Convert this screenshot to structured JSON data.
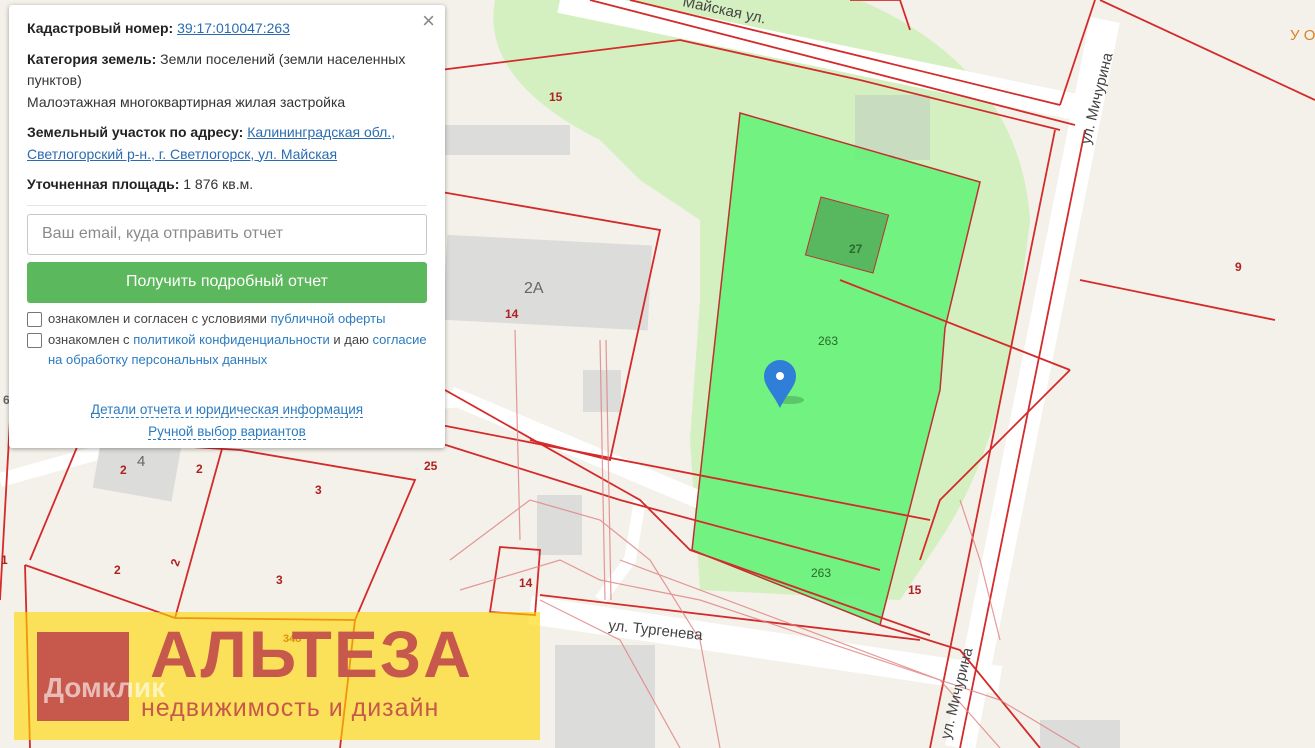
{
  "panel": {
    "close_icon": "×",
    "cadastral_label": "Кадастровый номер:",
    "cadastral_value": "39:17:010047:263",
    "category_label": "Категория земель:",
    "category_value": "Земли поселений (земли населенных пунктов)",
    "use_value": "Малоэтажная многоквартирная жилая застройка",
    "address_label": "Земельный участок по адресу:",
    "address_value": "Калининградская обл., Светлогорский р-н., г. Светлогорск, ул. Майская",
    "area_label": "Уточненная площадь:",
    "area_value": "1 876 кв.м.",
    "email_placeholder": "Ваш email, куда отправить отчет",
    "submit_label": "Получить подробный отчет",
    "consent1_text": "ознакомлен и согласен с условиями",
    "consent1_link": "публичной оферты",
    "consent2_text": "ознакомлен с",
    "consent2_link": "политикой конфиденциальности",
    "consent2_and": "и даю",
    "consent2_link2": "согласие на обработку персональных данных",
    "details_link": "Детали отчета и юридическая информация",
    "manual_link": "Ручной выбор вариантов"
  },
  "map": {
    "streets": {
      "mayskaya": "Майская ул.",
      "michurina_top": "ул. Мичурина",
      "michurina_bottom": "ул. Мичурина",
      "turgeneva": "ул. Тургенева"
    },
    "building_labels": {
      "b_2a": "2А",
      "b_4": "4"
    },
    "parcel_labels": {
      "p15a": "15",
      "p27": "27",
      "p263a": "263",
      "p263b": "263",
      "p9": "9",
      "p14a": "14",
      "p14b": "14",
      "p25": "25",
      "p2a": "2",
      "p2b": "2",
      "p2c": "2",
      "p2d": "2",
      "p3a": "3",
      "p3b": "3",
      "p15b": "15",
      "p1": "1",
      "p348": "348",
      "p_edge": "6"
    },
    "corner_text": "У О",
    "colors": {
      "selected_parcel": "#66f27a",
      "parcel_border": "#d42a2a",
      "park": "#d4f0c0",
      "marker": "#2f7ed8"
    },
    "marker_icon": "map-pin-icon"
  },
  "watermark": {
    "title": "АЛЬТЕЗА",
    "subtitle": "недвижимость и дизайн",
    "domclick": "Домклик"
  }
}
